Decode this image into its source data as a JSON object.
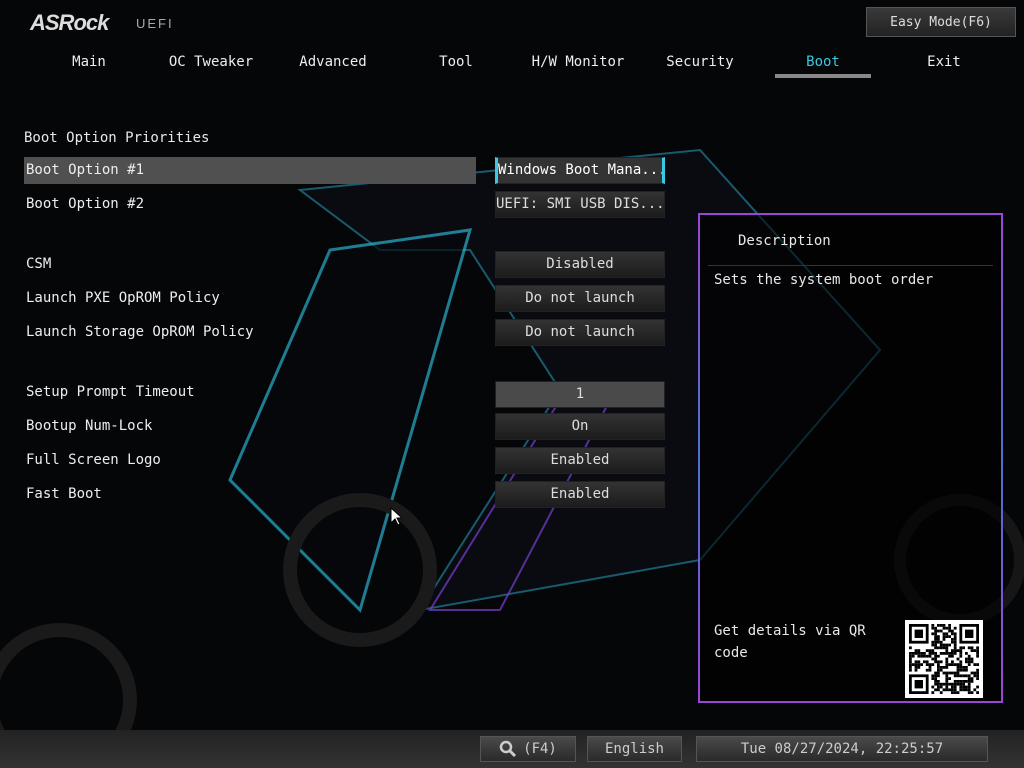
{
  "header": {
    "logo": "ASRock",
    "subtitle": "UEFI",
    "easy_mode": "Easy Mode(F6)"
  },
  "tabs": [
    {
      "label": "Main"
    },
    {
      "label": "OC Tweaker"
    },
    {
      "label": "Advanced"
    },
    {
      "label": "Tool"
    },
    {
      "label": "H/W Monitor"
    },
    {
      "label": "Security"
    },
    {
      "label": "Boot"
    },
    {
      "label": "Exit"
    }
  ],
  "active_tab": "Boot",
  "section_title": "Boot Option Priorities",
  "settings": [
    {
      "label": "Boot Option #1",
      "value": "Windows Boot Mana..."
    },
    {
      "label": "Boot Option #2",
      "value": "UEFI: SMI USB DIS..."
    },
    {
      "label": "CSM",
      "value": "Disabled"
    },
    {
      "label": "Launch PXE OpROM Policy",
      "value": "Do not launch"
    },
    {
      "label": "Launch Storage OpROM Policy",
      "value": "Do not launch"
    },
    {
      "label": "Setup Prompt Timeout",
      "value": "1"
    },
    {
      "label": "Bootup Num-Lock",
      "value": "On"
    },
    {
      "label": "Full Screen Logo",
      "value": "Enabled"
    },
    {
      "label": "Fast Boot",
      "value": "Enabled"
    }
  ],
  "description": {
    "title": "Description",
    "text": "Sets the system boot order",
    "qr_text": "Get details via QR code"
  },
  "footer": {
    "search": "(F4)",
    "language": "English",
    "datetime": "Tue 08/27/2024, 22:25:57"
  },
  "colors": {
    "accent": "#3cc8e0",
    "border": "#9b45d8"
  }
}
